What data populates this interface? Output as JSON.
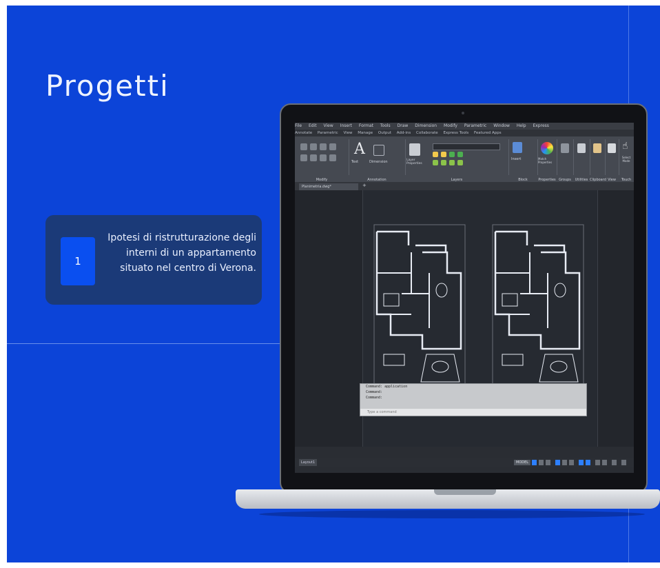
{
  "slide": {
    "title": "Progetti",
    "card": {
      "number": "1",
      "description_lines": [
        "Ipotesi di ristrutturazione degli",
        "interni di un appartamento",
        "situato nel centro di Verona."
      ]
    }
  },
  "cad_app": {
    "menu": [
      "File",
      "Edit",
      "View",
      "Insert",
      "Format",
      "Tools",
      "Draw",
      "Dimension",
      "Modify",
      "Parametric",
      "Window",
      "Help",
      "Express"
    ],
    "ribbon_tabs": [
      "Annotate",
      "Parametric",
      "View",
      "Manage",
      "Output",
      "Add-ins",
      "Collaborate",
      "Express Tools",
      "Featured Apps"
    ],
    "ribbon_groups": [
      "Modify",
      "Annotation",
      "Layers",
      "Block",
      "Properties",
      "Groups",
      "Utilities",
      "Clipboard",
      "View",
      "Touch"
    ],
    "ribbon_buttons": [
      "Text",
      "Dimension",
      "Layer Properties",
      "Insert",
      "Match Properties",
      "Select Mode"
    ],
    "doc_tab": "Planimetria.dwg*",
    "command_history": [
      "Command: application",
      "Command:",
      "Command:"
    ],
    "command_placeholder": "Type a command",
    "status_model": "MODEL",
    "layout_tab": "Layout1",
    "colors": {
      "accent": "#2d7fff",
      "background": "#0c44d8"
    }
  }
}
